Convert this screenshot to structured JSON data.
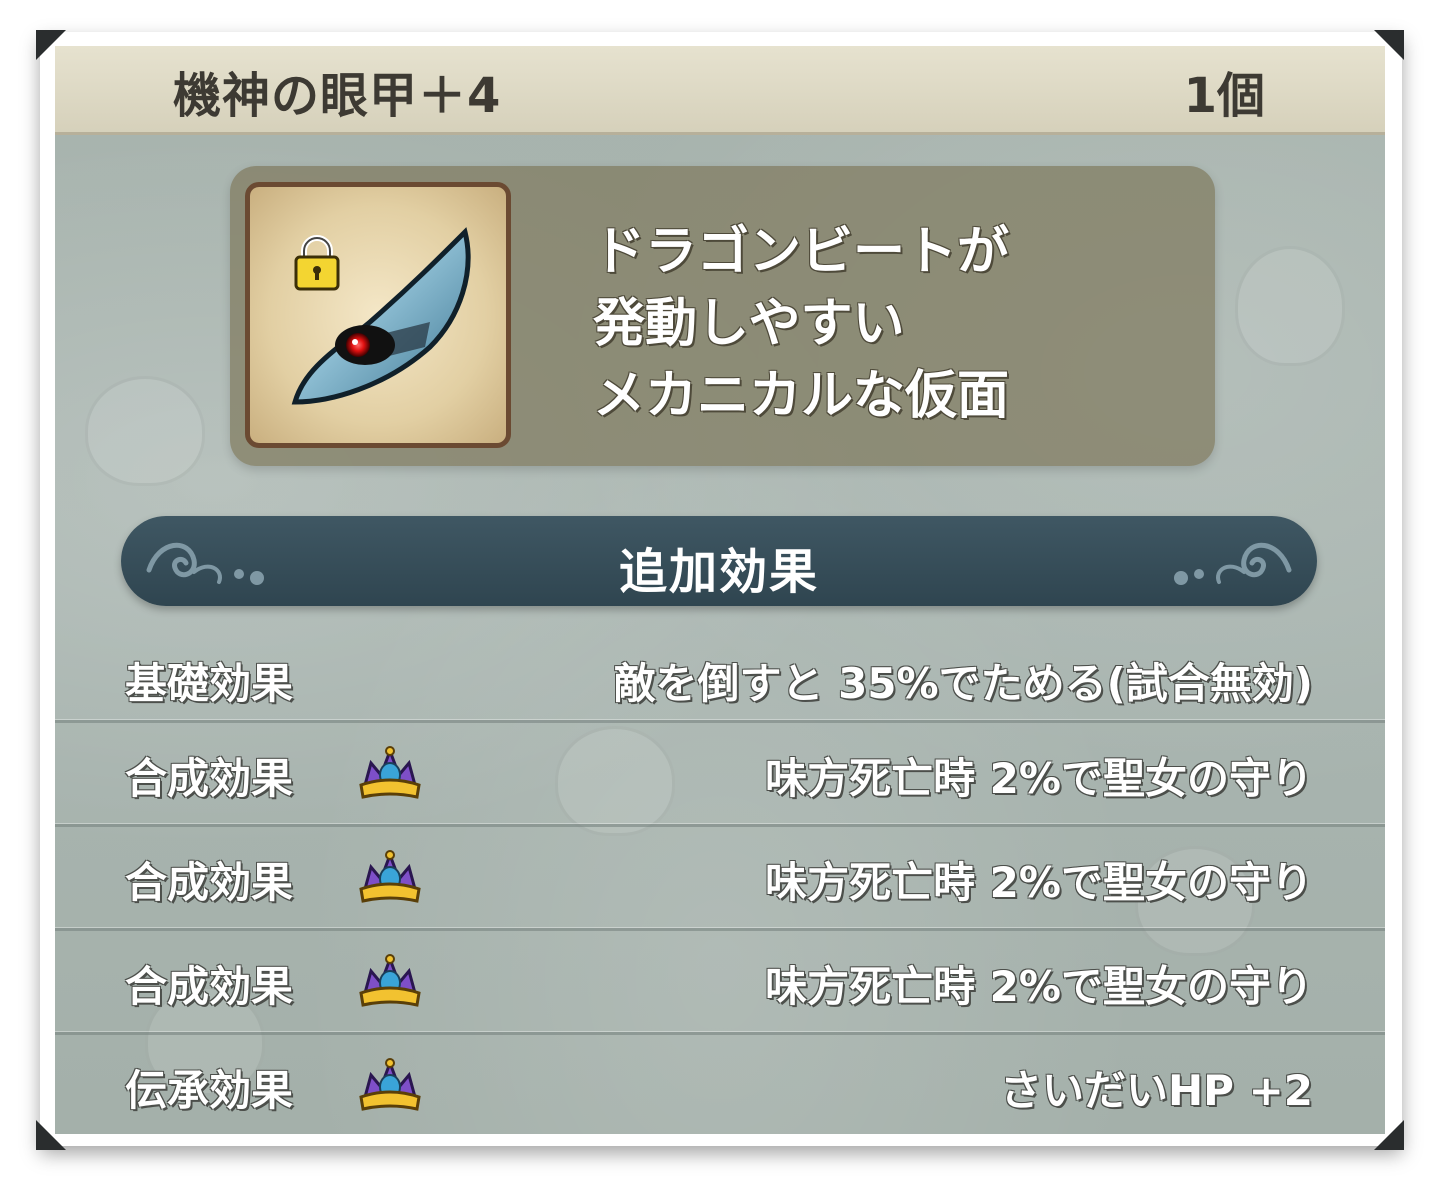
{
  "item": {
    "name": "機神の眼甲＋4",
    "count": "1個",
    "icon": "mask-icon",
    "locked": true
  },
  "description": {
    "lines": [
      "ドラゴンビートが",
      "発動しやすい",
      "メカニカルな仮面"
    ]
  },
  "section": {
    "title": "追加効果"
  },
  "effects": [
    {
      "label": "基礎効果",
      "icon": "",
      "value": "敵を倒すと 35%でためる(試合無効)"
    },
    {
      "label": "合成効果",
      "icon": "crown-icon",
      "value": "味方死亡時 2%で聖女の守り"
    },
    {
      "label": "合成効果",
      "icon": "crown-icon",
      "value": "味方死亡時 2%で聖女の守り"
    },
    {
      "label": "合成効果",
      "icon": "crown-icon",
      "value": "味方死亡時 2%で聖女の守り"
    },
    {
      "label": "伝承効果",
      "icon": "crown-icon",
      "value": "さいだいHP +2"
    }
  ],
  "colors": {
    "header_bg": "#e6e2cf",
    "panel_bg": "#a7b3ad",
    "section_bar": "#3f5763",
    "desc_box": "#807a5e"
  }
}
